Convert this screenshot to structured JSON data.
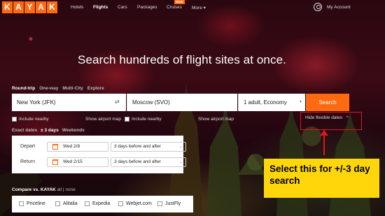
{
  "nav": {
    "logo": [
      "K",
      "A",
      "Y",
      "A",
      "K"
    ],
    "links": [
      "Hotels",
      "Flights",
      "Cars",
      "Packages",
      "Cruises",
      "More"
    ],
    "active": "Flights",
    "new_badge": "NEW",
    "more_caret": "▾",
    "account": "My Account"
  },
  "headline": "Search hundreds of flight sites at once.",
  "trip_tabs": [
    "Round-trip",
    "One-way",
    "Multi-City",
    "Explore"
  ],
  "search": {
    "origin": "New York (JFK)",
    "swap_icon": "⇄",
    "destination": "Moscow (SVO)",
    "travelers": "1 adult, Economy",
    "travelers_caret": "▾",
    "button": "Search"
  },
  "options": {
    "include_nearby_1": "Include nearby",
    "show_airport_map_1": "Show airport map",
    "include_nearby_2": "Include nearby",
    "show_airport_map_2": "Show airport map",
    "hide_flexible_dates": "Hide flexible dates",
    "hide_caret": "^"
  },
  "flex_tabs": [
    "Exact dates",
    "± 3 days",
    "Weekends"
  ],
  "flex_panel": {
    "depart_label": "Depart",
    "depart_date": "Wed 2/8",
    "depart_range": "3 days before and after",
    "return_label": "Return",
    "return_date": "Wed 2/15",
    "return_range": "3 days before and after",
    "range_caret": "⌄"
  },
  "callout": "Select this for +/-3 day search",
  "compare": {
    "title": "Compare vs. KAYAK",
    "links": "all | none",
    "sites": [
      "Priceline",
      "Alitalia",
      "Expedia",
      "Webjet.com",
      "JustFly"
    ]
  },
  "colors": {
    "brand": "#ff690f",
    "annotation_red": "#e0141e",
    "callout_yellow": "#ffd60a"
  }
}
